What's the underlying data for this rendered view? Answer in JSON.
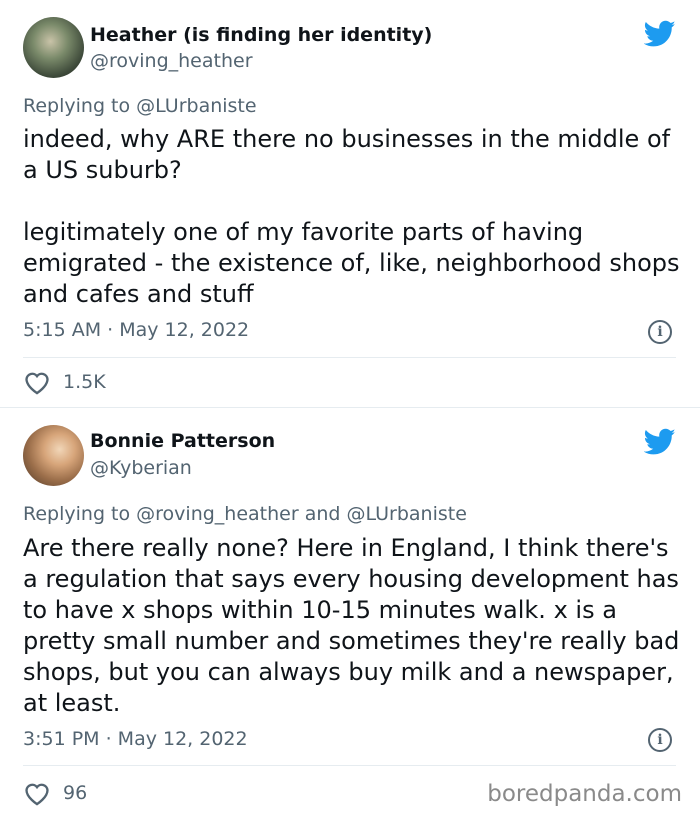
{
  "tweets": [
    {
      "author_name": "Heather (is finding her identity)",
      "handle": "@roving_heather",
      "replying_to": "Replying to @LUrbaniste",
      "body_paragraphs": [
        "indeed, why ARE there no businesses in the middle of a US suburb?",
        "legitimately one of my favorite parts of having emigrated - the existence of, like, neighborhood shops and cafes and stuff"
      ],
      "timestamp": "5:15 AM · May 12, 2022",
      "likes": "1.5K"
    },
    {
      "author_name": "Bonnie Patterson",
      "handle": "@Kyberian",
      "replying_to": "Replying to @roving_heather and @LUrbaniste",
      "body_paragraphs": [
        "Are there really none? Here in England, I think there's a regulation that says every housing development has to have x shops within 10-15 minutes walk. x is a pretty small number and sometimes they're really bad shops, but you can always buy milk and a newspaper, at least."
      ],
      "timestamp": "3:51 PM · May 12, 2022",
      "likes": "96"
    }
  ],
  "info_glyph": "i",
  "watermark": "boredpanda.com",
  "colors": {
    "twitter_blue": "#1d9bf0",
    "secondary_text": "#536471",
    "divider": "#e6ecf0"
  },
  "icons": [
    "twitter-bird-icon",
    "info-icon",
    "heart-icon"
  ]
}
